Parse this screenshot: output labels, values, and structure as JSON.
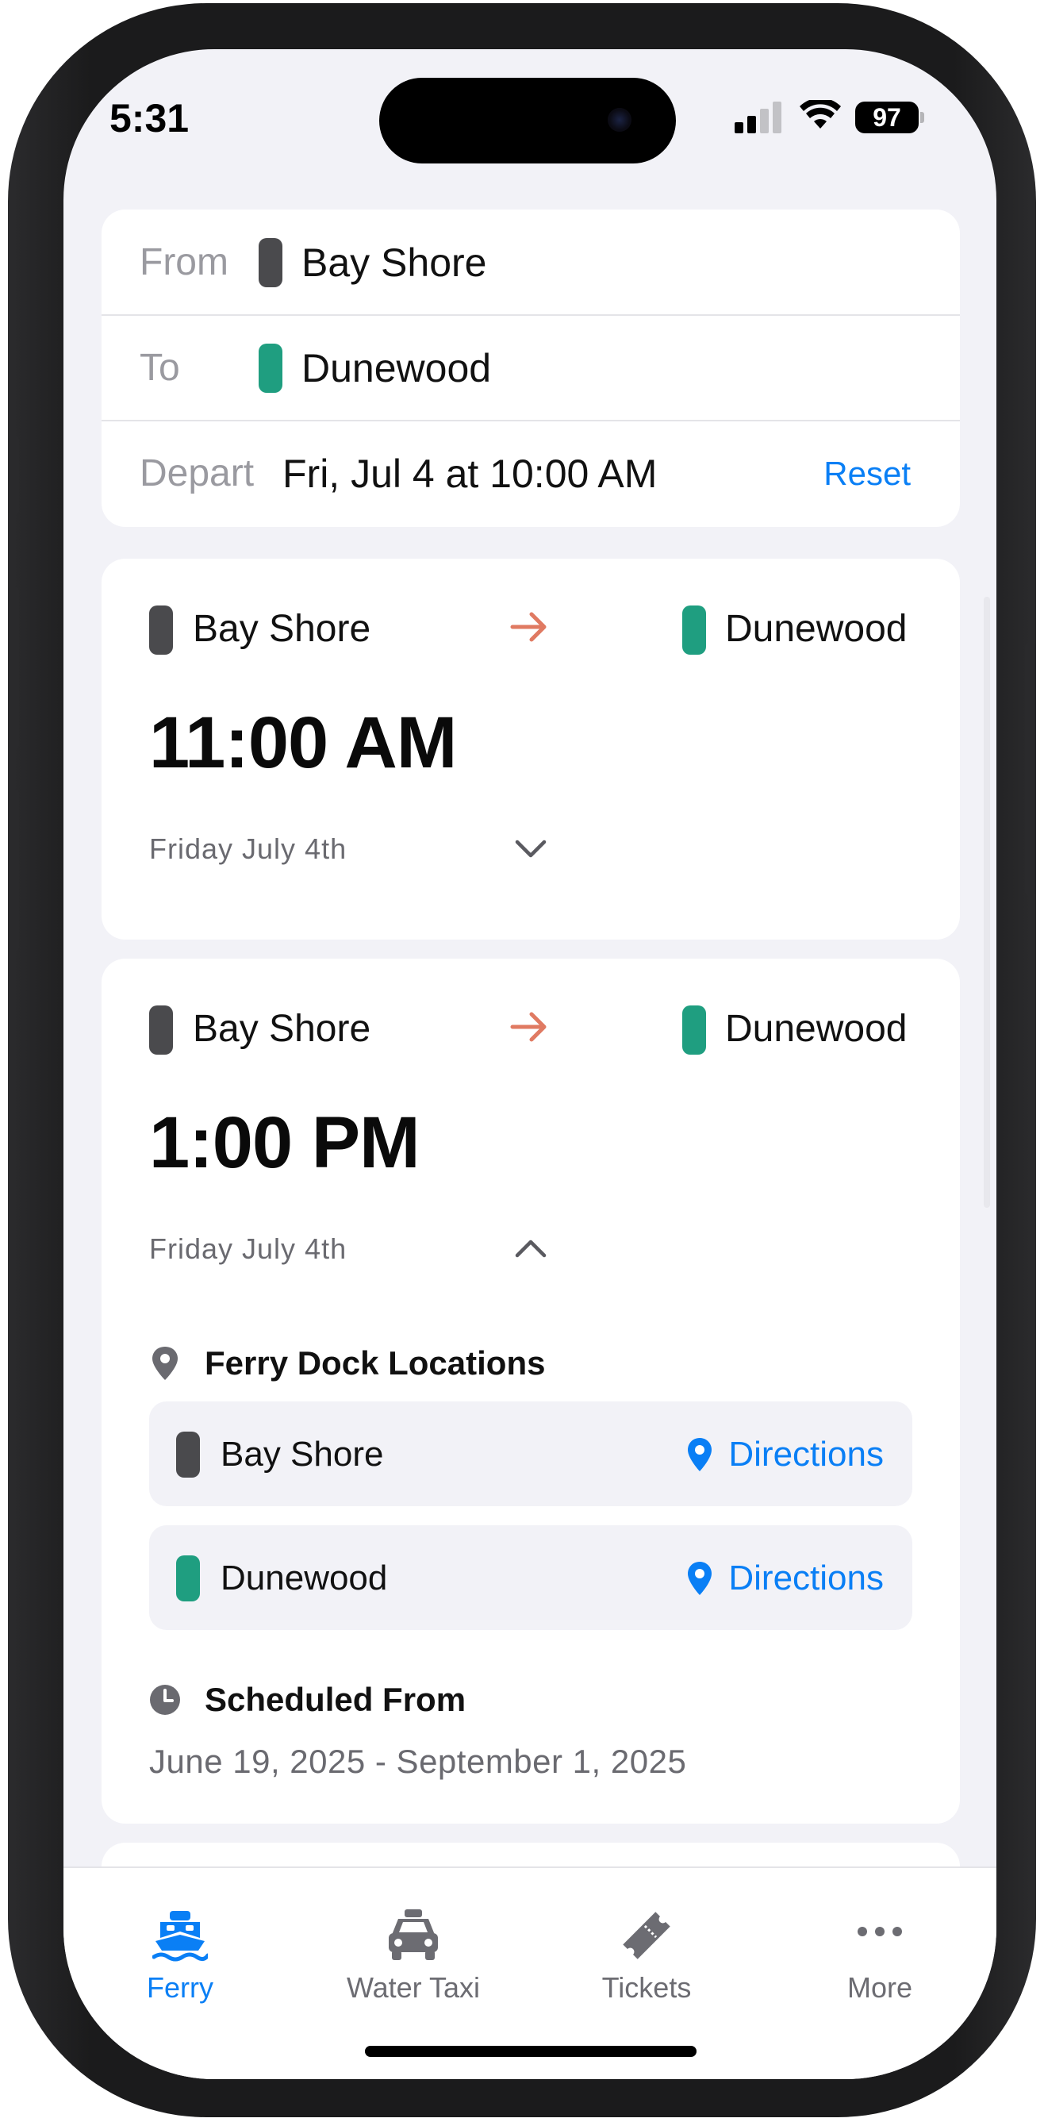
{
  "status_bar": {
    "time": "5:31",
    "battery": "97"
  },
  "search": {
    "from_label": "From",
    "from_value": "Bay Shore",
    "to_label": "To",
    "to_value": "Dunewood",
    "depart_label": "Depart",
    "depart_value": "Fri, Jul 4 at 10:00 AM",
    "reset_label": "Reset"
  },
  "trips": [
    {
      "origin": "Bay Shore",
      "destination": "Dunewood",
      "time": "11:00 AM",
      "date": "Friday July 4th",
      "expanded": false
    },
    {
      "origin": "Bay Shore",
      "destination": "Dunewood",
      "time": "1:00 PM",
      "date": "Friday July 4th",
      "expanded": true,
      "dock_section_title": "Ferry Dock Locations",
      "docks": [
        {
          "name": "Bay Shore",
          "link": "Directions"
        },
        {
          "name": "Dunewood",
          "link": "Directions"
        }
      ],
      "schedule_title": "Scheduled From",
      "schedule_range": "June 19, 2025 - September 1, 2025"
    }
  ],
  "tabs": [
    {
      "label": "Ferry",
      "icon": "ferry-icon",
      "active": true
    },
    {
      "label": "Water Taxi",
      "icon": "taxi-icon",
      "active": false
    },
    {
      "label": "Tickets",
      "icon": "ticket-icon",
      "active": false
    },
    {
      "label": "More",
      "icon": "more-icon",
      "active": false
    }
  ],
  "colors": {
    "accent": "#0a7ff5",
    "origin_pill": "#4a4a4d",
    "destination_pill": "#1f9e80",
    "arrow": "#e07a62",
    "background": "#f2f2f7"
  }
}
